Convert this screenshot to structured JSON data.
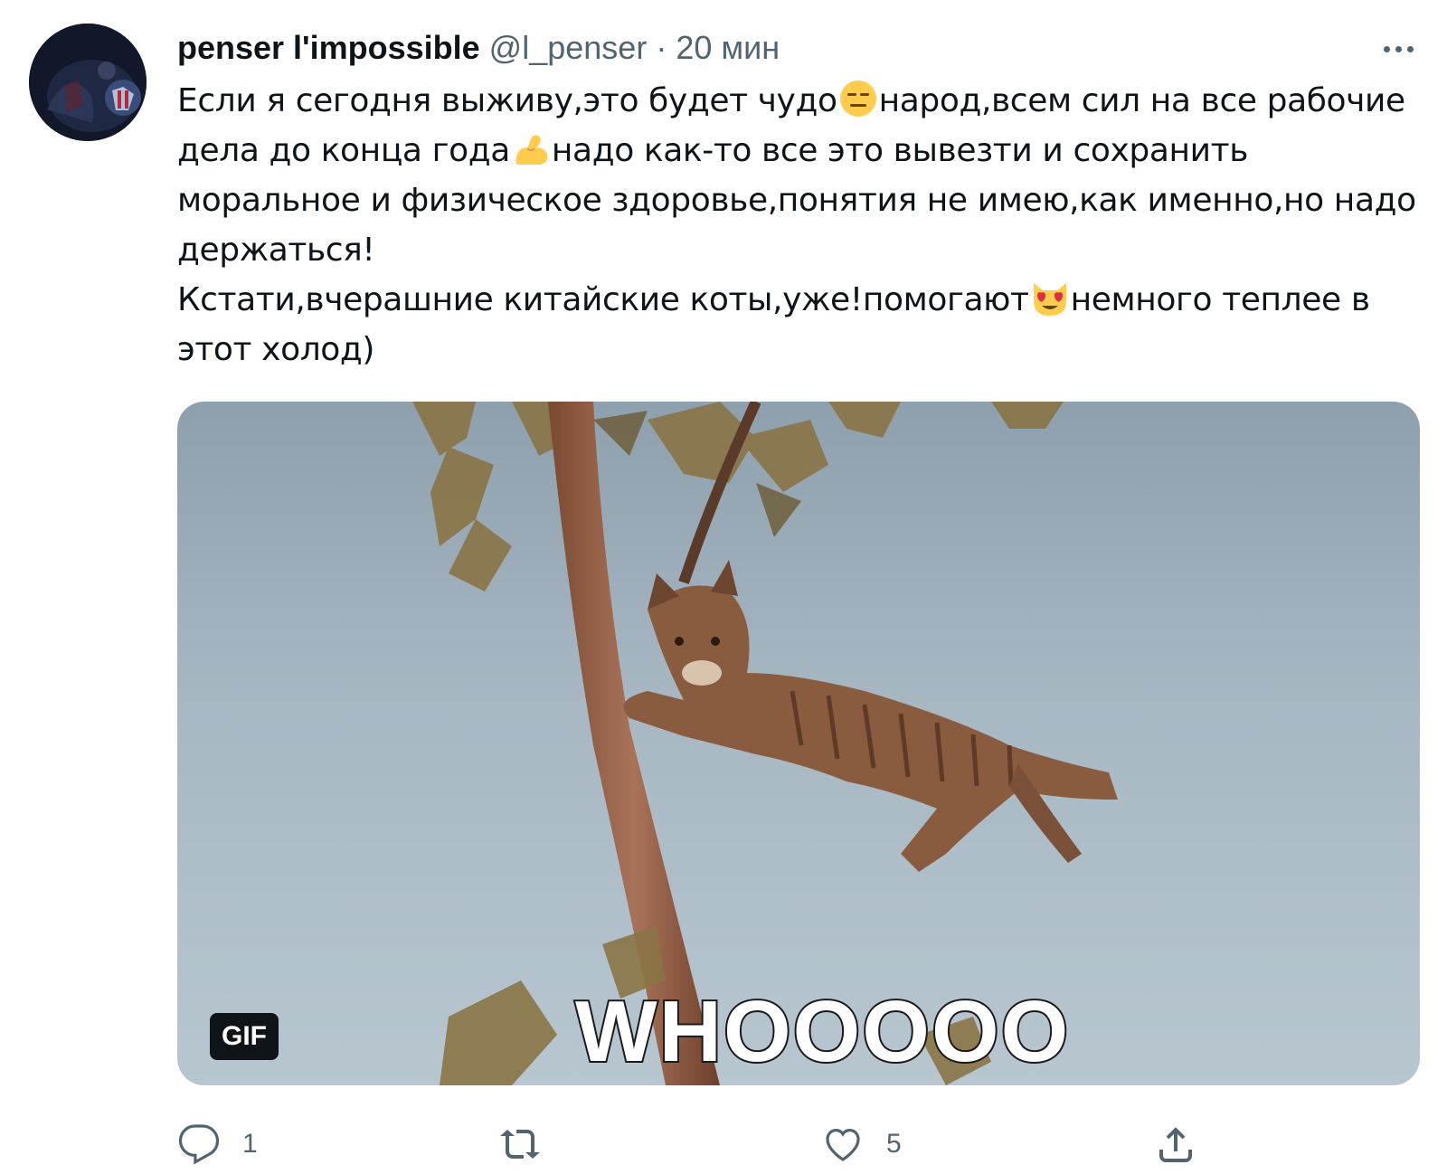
{
  "tweet": {
    "display_name": "penser l'impossible",
    "handle": "@l_penser",
    "separator": "·",
    "time": "20 мин",
    "text": {
      "p1_a": "Если я сегодня выживу,это будет чудо",
      "p1_b": "народ,всем сил на все рабочие дела до конца года",
      "p1_c": "надо как-то все это вывезти и сохранить моральное и физическое здоровье,понятия не имею,как именно,но надо держаться!",
      "p2_a": "Кстати,вчерашние китайские коты,уже!помогают",
      "p2_b": "немного теплее в этот холод)"
    },
    "emojis": [
      "expressionless-face-emoji",
      "flexed-biceps-emoji",
      "heart-eyes-cat-emoji"
    ],
    "media": {
      "type": "gif",
      "badge": "GIF",
      "caption": "WHOOOOO"
    },
    "actions": {
      "reply_count": "1",
      "retweet_count": "",
      "like_count": "5"
    }
  },
  "colors": {
    "text_primary": "#0f1419",
    "text_secondary": "#536471",
    "background": "#ffffff"
  }
}
